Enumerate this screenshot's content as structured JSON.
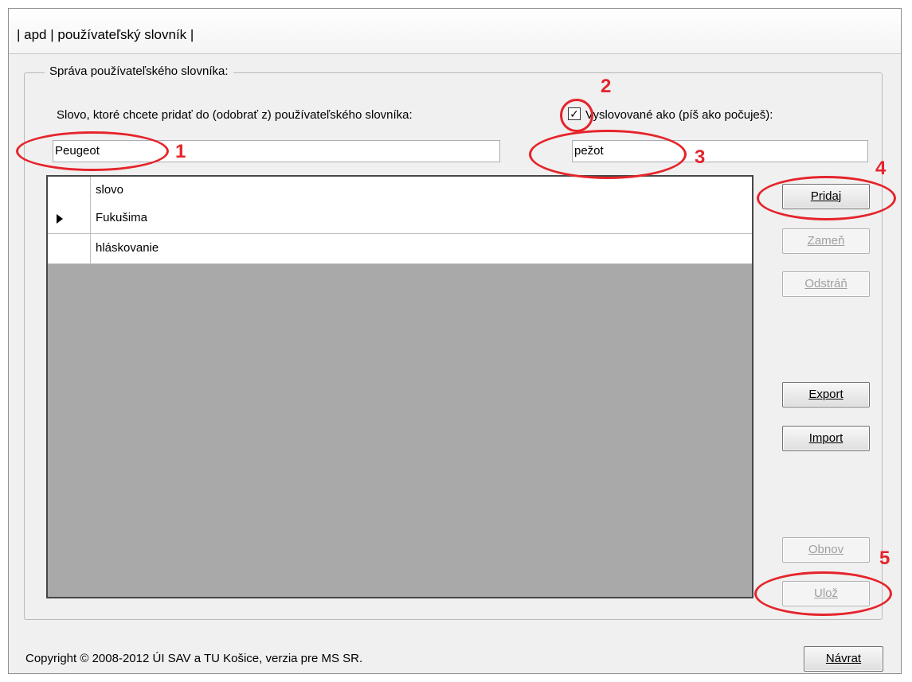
{
  "window": {
    "title": "| apd | používateľský slovník |"
  },
  "group": {
    "legend": "Správa používateľského slovníka:"
  },
  "word_label": "Slovo, ktoré chcete pridať do (odobrať z) používateľského slovníka:",
  "word_value": "Peugeot",
  "pronounced_checkbox": {
    "checked": true,
    "label": "Vyslovované ako (píš ako počuješ):"
  },
  "pronounced_value": "pežot",
  "grid": {
    "column": "slovo",
    "rows": [
      "Fukušima",
      "hláskovanie"
    ],
    "selected_row": 0
  },
  "buttons": {
    "add": "Pridaj",
    "replace": "Zameň",
    "remove": "Odstráň",
    "export": "Export",
    "import": "Import",
    "refresh": "Obnov",
    "save": "Ulož",
    "back": "Návrat"
  },
  "footer": {
    "copyright": "Copyright © 2008-2012 ÚI SAV a TU Košice, verzia pre MS SR."
  },
  "annotations": [
    "1",
    "2",
    "3",
    "4",
    "5"
  ],
  "colors": {
    "annotation": "#e5242b",
    "grid_background": "#a9a9a9"
  }
}
